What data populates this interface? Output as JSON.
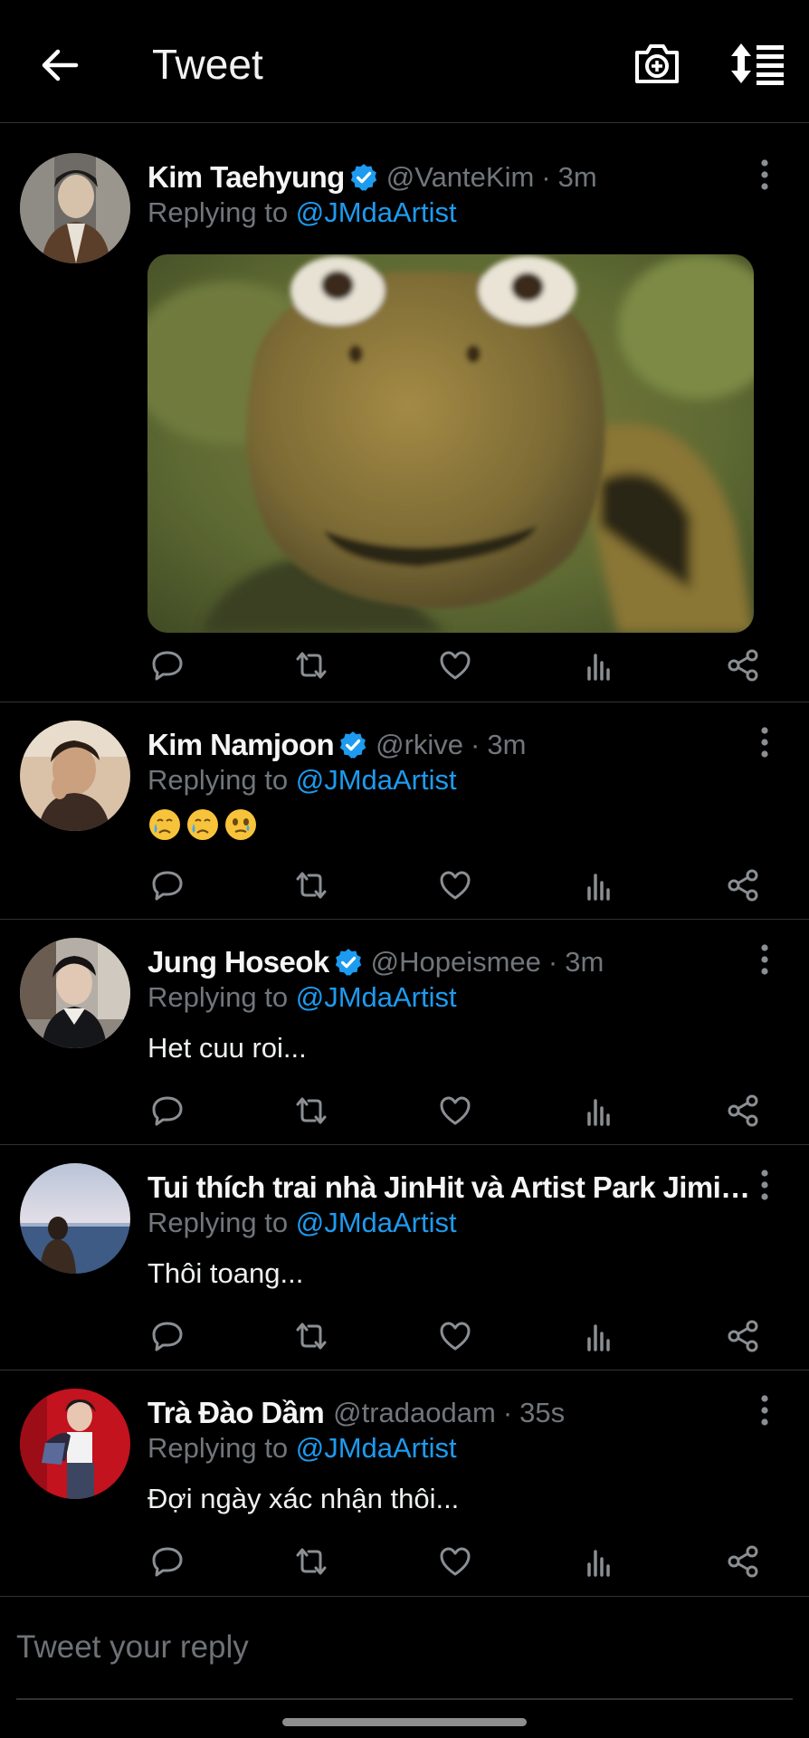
{
  "header": {
    "title": "Tweet",
    "icons": {
      "back": "arrow-left-icon",
      "camera": "camera-plus-icon",
      "sort": "sort-replies-icon"
    }
  },
  "colors": {
    "background": "#000000",
    "accent": "#1d9bf0",
    "muted": "#71767b",
    "divider": "#2f3336"
  },
  "tweets": [
    {
      "name": "Kim Taehyung",
      "verified": true,
      "handle": "@VanteKim",
      "separator": "·",
      "time": "3m",
      "replying_prefix": "Replying to",
      "replying_to": "@JMdaArtist",
      "media": "photo of a blurry turtle face"
    },
    {
      "name": "Kim Namjoon",
      "verified": true,
      "handle": "@rkive",
      "separator": "·",
      "time": "3m",
      "replying_prefix": "Replying to",
      "replying_to": "@JMdaArtist",
      "emojis": [
        "crying-face-emoji",
        "crying-face-emoji",
        "face-holding-back-tears-emoji"
      ]
    },
    {
      "name": "Jung Hoseok",
      "verified": true,
      "handle": "@Hopeismee",
      "separator": "·",
      "time": "3m",
      "replying_prefix": "Replying to",
      "replying_to": "@JMdaArtist",
      "text": "Het cuu roi..."
    },
    {
      "name": "Tui thích trai nhà JinHit và Artist Park Jimin …",
      "verified": false,
      "replying_prefix": "Replying to",
      "replying_to": "@JMdaArtist",
      "text": "Thôi toang..."
    },
    {
      "name": "Trà Đào Dầm",
      "verified": false,
      "handle": "@tradaodam",
      "separator": "·",
      "time": "35s",
      "replying_prefix": "Replying to",
      "replying_to": "@JMdaArtist",
      "text": "Đợi ngày xác nhận thôi..."
    }
  ],
  "action_icons": [
    "reply-icon",
    "retweet-icon",
    "like-icon",
    "analytics-icon",
    "share-icon"
  ],
  "reply_box": {
    "placeholder": "Tweet your reply",
    "value": ""
  }
}
